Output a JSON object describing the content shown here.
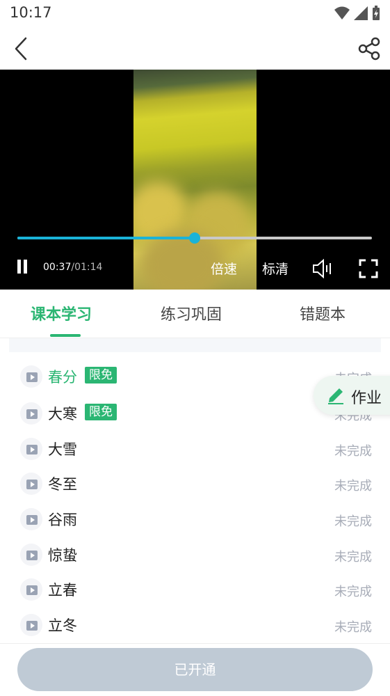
{
  "status_bar": {
    "time": "10:17"
  },
  "header": {
    "back_icon": "chevron-left-icon",
    "share_icon": "share-icon"
  },
  "video": {
    "progress": 0.5,
    "current_time": "00:37",
    "total_time": "/01:14",
    "speed_label": "倍速",
    "quality_label": "标清",
    "accent_color": "#1ab3d8"
  },
  "tabs": [
    {
      "label": "课本学习",
      "active": true
    },
    {
      "label": "练习巩固",
      "active": false
    },
    {
      "label": "错题本",
      "active": false
    }
  ],
  "lessons": [
    {
      "title": "春分",
      "badge": "限免",
      "status": "未完成"
    },
    {
      "title": "大寒",
      "badge": "限免",
      "status": "未完成"
    },
    {
      "title": "大雪",
      "badge": "",
      "status": "未完成"
    },
    {
      "title": "冬至",
      "badge": "",
      "status": "未完成"
    },
    {
      "title": "谷雨",
      "badge": "",
      "status": "未完成"
    },
    {
      "title": "惊蛰",
      "badge": "",
      "status": "未完成"
    },
    {
      "title": "立春",
      "badge": "",
      "status": "未完成"
    },
    {
      "title": "立冬",
      "badge": "",
      "status": "未完成"
    }
  ],
  "homework": {
    "label": "作业",
    "icon": "pencil-icon"
  },
  "footer": {
    "button_label": "已开通"
  },
  "colors": {
    "primary": "#2bb673",
    "disabled_button": "#bfcad5"
  }
}
